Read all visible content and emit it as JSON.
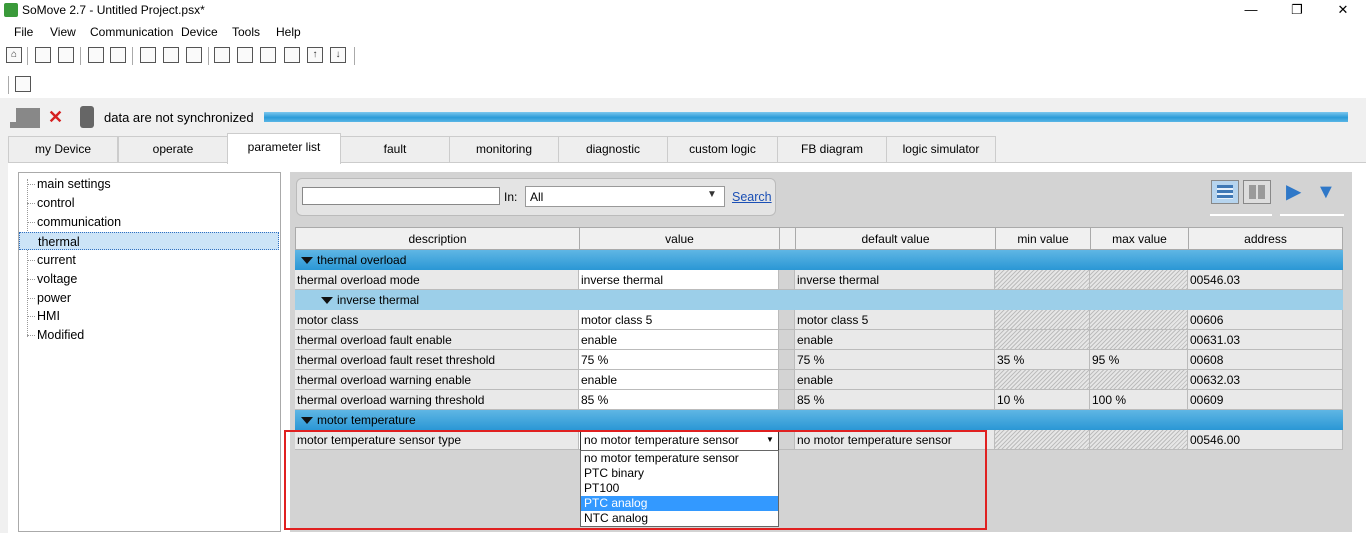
{
  "window": {
    "title": "SoMove 2.7 - Untitled Project.psx*",
    "min": "—",
    "max": "❐",
    "close": "✕"
  },
  "menu": [
    "File",
    "View",
    "Communication",
    "Device",
    "Tools",
    "Help"
  ],
  "sync": {
    "status": "data are not synchronized"
  },
  "tabs": [
    "my Device",
    "operate",
    "parameter list",
    "fault",
    "monitoring",
    "diagnostic",
    "custom logic",
    "FB diagram",
    "logic simulator"
  ],
  "tree": [
    "main settings",
    "control",
    "communication",
    "thermal",
    "current",
    "voltage",
    "power",
    "HMI",
    "Modified"
  ],
  "search": {
    "in_label": "In:",
    "in_value": "All",
    "button": "Search"
  },
  "table": {
    "headers": [
      "description",
      "value",
      "default value",
      "min value",
      "max value",
      "address"
    ],
    "groups": {
      "thermal_overload": "thermal overload",
      "inverse_thermal": "inverse thermal",
      "motor_temperature": "motor temperature"
    },
    "rows": [
      {
        "desc": "thermal overload mode",
        "value": "inverse thermal",
        "default": "inverse thermal",
        "min": "",
        "max": "",
        "addr": "00546.03"
      },
      {
        "desc": "motor class",
        "value": "motor class 5",
        "default": "motor class 5",
        "min": "",
        "max": "",
        "addr": "00606"
      },
      {
        "desc": "thermal overload fault enable",
        "value": "enable",
        "default": "enable",
        "min": "",
        "max": "",
        "addr": "00631.03"
      },
      {
        "desc": "thermal overload fault reset threshold",
        "value": "75 %",
        "default": "75 %",
        "min": "35 %",
        "max": "95 %",
        "addr": "00608"
      },
      {
        "desc": "thermal overload warning enable",
        "value": "enable",
        "default": "enable",
        "min": "",
        "max": "",
        "addr": "00632.03"
      },
      {
        "desc": "thermal overload warning threshold",
        "value": "85 %",
        "default": "85 %",
        "min": "10 %",
        "max": "100 %",
        "addr": "00609"
      },
      {
        "desc": "motor temperature sensor type",
        "value": "no motor temperature sensor",
        "default": "no motor temperature sensor",
        "min": "",
        "max": "",
        "addr": "00546.00"
      }
    ]
  },
  "dropdown": {
    "options": [
      "no motor temperature sensor",
      "PTC binary",
      "PT100",
      "PTC analog",
      "NTC analog"
    ],
    "hovered": "PTC analog"
  }
}
